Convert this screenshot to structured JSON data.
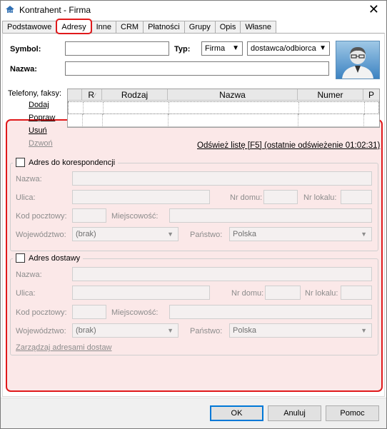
{
  "window": {
    "title": "Kontrahent - Firma",
    "close": "✕"
  },
  "tabs": [
    "Podstawowe",
    "Adresy",
    "Inne",
    "CRM",
    "Płatności",
    "Grupy",
    "Opis",
    "Własne"
  ],
  "form": {
    "symbol_label": "Symbol:",
    "symbol_value": "",
    "type_label": "Typ:",
    "type_value": "Firma",
    "role_value": "dostawca/odbiorca",
    "name_label": "Nazwa:",
    "name_value": ""
  },
  "phones": {
    "label": "Telefony, faksy:",
    "columns": [
      "R",
      "Rodzaj",
      "Nazwa",
      "Numer",
      "P"
    ],
    "actions": [
      "Dodaj",
      "Popraw",
      "Usuń",
      "Dzwoń"
    ],
    "refresh": "Odśwież listę [F5] (ostatnie odświeżenie 01:02:31)"
  },
  "correspondence": {
    "legend": "Adres do korespondencji",
    "name_label": "Nazwa:",
    "street_label": "Ulica:",
    "house_label": "Nr domu:",
    "flat_label": "Nr lokalu:",
    "postal_label": "Kod pocztowy:",
    "city_label": "Miejscowość:",
    "voivodeship_label": "Województwo:",
    "voivodeship_value": "(brak)",
    "country_label": "Państwo:",
    "country_value": "Polska"
  },
  "delivery": {
    "legend": "Adres dostawy",
    "name_label": "Nazwa:",
    "street_label": "Ulica:",
    "house_label": "Nr domu:",
    "flat_label": "Nr lokalu:",
    "postal_label": "Kod pocztowy:",
    "city_label": "Miejscowość:",
    "voivodeship_label": "Województwo:",
    "voivodeship_value": "(brak)",
    "country_label": "Państwo:",
    "country_value": "Polska",
    "manage_link": "Zarządzaj adresami dostaw"
  },
  "buttons": {
    "ok": "OK",
    "cancel": "Anuluj",
    "help": "Pomoc"
  },
  "colors": {
    "highlight": "#e0191b",
    "panel_bg": "#fbe8e8",
    "default_button_border": "#0078d7"
  }
}
